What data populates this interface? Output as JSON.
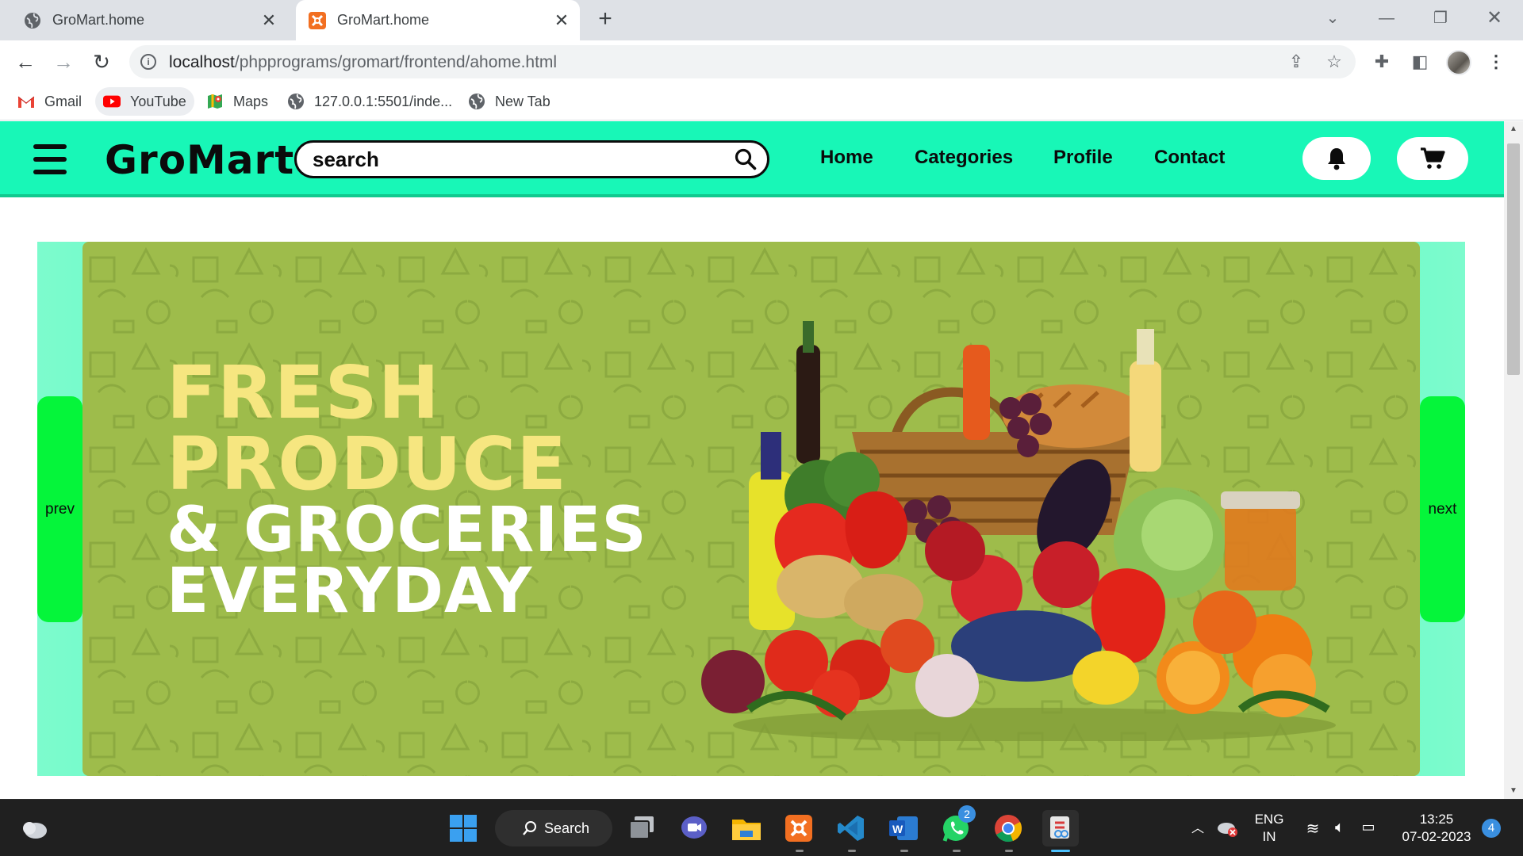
{
  "browser": {
    "tabs": [
      {
        "title": "GroMart.home",
        "active": false
      },
      {
        "title": "GroMart.home",
        "active": true
      }
    ],
    "url_host": "localhost",
    "url_path": "/phpprograms/gromart/frontend/ahome.html",
    "bookmarks": [
      {
        "label": "Gmail"
      },
      {
        "label": "YouTube"
      },
      {
        "label": "Maps"
      },
      {
        "label": "127.0.0.1:5501/inde..."
      },
      {
        "label": "New Tab"
      }
    ]
  },
  "site": {
    "logo": "GroMart",
    "search_placeholder": "search",
    "nav": [
      "Home",
      "Categories",
      "Profile",
      "Contact"
    ],
    "colors": {
      "header": "#18f7b7",
      "carousel_button": "#05f53a",
      "banner": "#9ebc4b"
    }
  },
  "banner": {
    "line1": "FRESH",
    "line2": "PRODUCE",
    "line3": "& GROCERIES",
    "line4": "EVERYDAY",
    "prev_label": "prev",
    "next_label": "next"
  },
  "taskbar": {
    "search_label": "Search",
    "lang_line1": "ENG",
    "lang_line2": "IN",
    "time": "13:25",
    "date": "07-02-2023",
    "notification_count": "4",
    "whatsapp_badge": "2"
  }
}
